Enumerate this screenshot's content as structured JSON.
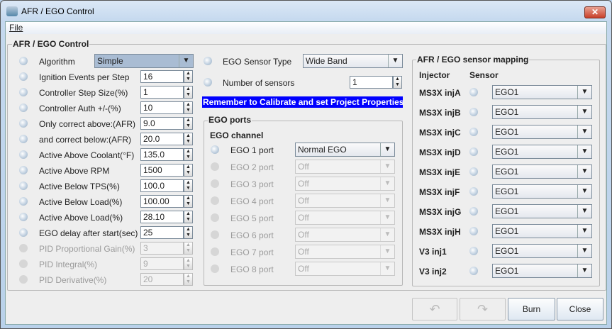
{
  "window": {
    "title": "AFR / EGO Control"
  },
  "menu": {
    "file": "File"
  },
  "main_group": {
    "title": "AFR / EGO Control"
  },
  "left": [
    {
      "label": "Algorithm",
      "type": "combo",
      "value": "Simple",
      "enabled": true
    },
    {
      "label": "Ignition Events per Step",
      "type": "spin",
      "value": "16",
      "enabled": true
    },
    {
      "label": "Controller Step Size(%)",
      "type": "spin",
      "value": "1",
      "enabled": true
    },
    {
      "label": "Controller Auth +/-(%)",
      "type": "spin",
      "value": "10",
      "enabled": true
    },
    {
      "label": "Only correct above:(AFR)",
      "type": "spin",
      "value": "9.0",
      "enabled": true
    },
    {
      "label": "and correct below:(AFR)",
      "type": "spin",
      "value": "20.0",
      "enabled": true
    },
    {
      "label": "Active Above Coolant(°F)",
      "type": "spin",
      "value": "135.0",
      "enabled": true
    },
    {
      "label": "Active Above RPM",
      "type": "spin",
      "value": "1500",
      "enabled": true
    },
    {
      "label": "Active Below TPS(%)",
      "type": "spin",
      "value": "100.0",
      "enabled": true
    },
    {
      "label": "Active Below Load(%)",
      "type": "spin",
      "value": "100.00",
      "enabled": true
    },
    {
      "label": "Active Above Load(%)",
      "type": "spin",
      "value": "28.10",
      "enabled": true
    },
    {
      "label": "EGO delay after start(sec)",
      "type": "spin",
      "value": "25",
      "enabled": true
    },
    {
      "label": "PID Proportional Gain(%)",
      "type": "spin",
      "value": "3",
      "enabled": false
    },
    {
      "label": "PID Integral(%)",
      "type": "spin",
      "value": "9",
      "enabled": false
    },
    {
      "label": "PID Derivative(%)",
      "type": "spin",
      "value": "20",
      "enabled": false
    }
  ],
  "middle": {
    "sensor_type_label": "EGO Sensor Type",
    "sensor_type_value": "Wide Band",
    "num_sensors_label": "Number of sensors",
    "num_sensors_value": "1",
    "banner": "Remember to Calibrate and set Project Properties",
    "ports_group_title": "EGO ports",
    "channel_header": "EGO channel",
    "ports": [
      {
        "label": "EGO 1 port",
        "value": "Normal EGO",
        "enabled": true
      },
      {
        "label": "EGO 2 port",
        "value": "Off",
        "enabled": false
      },
      {
        "label": "EGO 3 port",
        "value": "Off",
        "enabled": false
      },
      {
        "label": "EGO 4 port",
        "value": "Off",
        "enabled": false
      },
      {
        "label": "EGO 5 port",
        "value": "Off",
        "enabled": false
      },
      {
        "label": "EGO 6 port",
        "value": "Off",
        "enabled": false
      },
      {
        "label": "EGO 7 port",
        "value": "Off",
        "enabled": false
      },
      {
        "label": "EGO 8 port",
        "value": "Off",
        "enabled": false
      }
    ]
  },
  "mapping": {
    "title": "AFR / EGO sensor mapping",
    "injector_header": "Injector",
    "sensor_header": "Sensor",
    "rows": [
      {
        "injector": "MS3X injA",
        "sensor": "EGO1"
      },
      {
        "injector": "MS3X injB",
        "sensor": "EGO1"
      },
      {
        "injector": "MS3X injC",
        "sensor": "EGO1"
      },
      {
        "injector": "MS3X injD",
        "sensor": "EGO1"
      },
      {
        "injector": "MS3X injE",
        "sensor": "EGO1"
      },
      {
        "injector": "MS3X injF",
        "sensor": "EGO1"
      },
      {
        "injector": "MS3X injG",
        "sensor": "EGO1"
      },
      {
        "injector": "MS3X injH",
        "sensor": "EGO1"
      },
      {
        "injector": "V3 inj1",
        "sensor": "EGO1"
      },
      {
        "injector": "V3 inj2",
        "sensor": "EGO1"
      }
    ]
  },
  "buttons": {
    "undo_icon": "undo-arrow",
    "redo_icon": "redo-arrow",
    "burn": "Burn",
    "close": "Close"
  },
  "colors": {
    "banner": "#0000ff",
    "titlebar": "#c4d8ee"
  }
}
